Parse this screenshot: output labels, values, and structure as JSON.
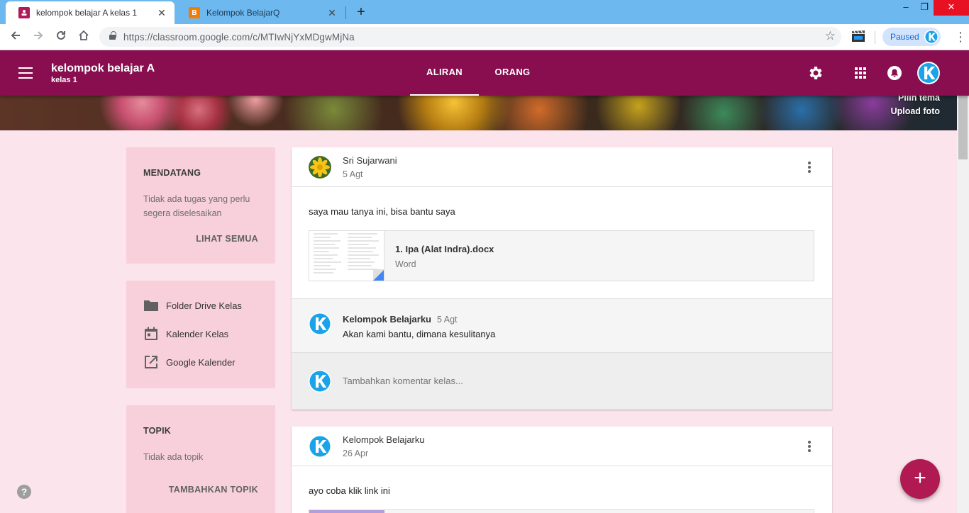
{
  "browser": {
    "tabs": [
      {
        "title": "kelompok belajar A kelas 1",
        "active": true,
        "favicon": "classroom-icon"
      },
      {
        "title": "Kelompok BelajarQ",
        "active": false,
        "favicon": "blogger-icon"
      }
    ],
    "window_controls": {
      "minimize": "–",
      "restore": "❐",
      "close": "✕"
    },
    "new_tab": "+",
    "url": "https://classroom.google.com/c/MTIwNjYxMDgwMjNa",
    "profile_status": "Paused",
    "colors": {
      "tabstrip": "#6cb8ef",
      "close_button": "#e81123"
    }
  },
  "header": {
    "class_name": "kelompok belajar A",
    "section": "kelas 1",
    "tabs": [
      {
        "label": "ALIRAN",
        "active": true
      },
      {
        "label": "ORANG",
        "active": false
      }
    ],
    "icons": [
      "gear-icon",
      "apps-grid-icon",
      "notifications-icon",
      "account-avatar"
    ],
    "color": "#880e4f"
  },
  "banner": {
    "select_theme": "Pilih tema",
    "upload_photo": "Upload foto"
  },
  "sidebar": {
    "upcoming": {
      "heading": "MENDATANG",
      "text": "Tidak ada tugas yang perlu segera diselesaikan",
      "action": "LIHAT SEMUA"
    },
    "links": [
      {
        "label": "Folder Drive Kelas",
        "icon": "folder-icon"
      },
      {
        "label": "Kalender Kelas",
        "icon": "calendar-icon"
      },
      {
        "label": "Google Kalender",
        "icon": "open-in-new-icon"
      }
    ],
    "topics": {
      "heading": "TOPIK",
      "text": "Tidak ada topik",
      "action": "TAMBAHKAN TOPIK"
    }
  },
  "posts": [
    {
      "author": "Sri Sujarwani",
      "date": "5 Agt",
      "body": "saya mau tanya ini, bisa bantu saya",
      "attachment": {
        "name": "1. Ipa (Alat Indra).docx",
        "type": "Word"
      },
      "comments": [
        {
          "author": "Kelompok Belajarku",
          "date": "5 Agt",
          "text": "Akan kami bantu, dimana kesulitanya"
        }
      ],
      "comment_placeholder": "Tambahkan komentar kelas..."
    },
    {
      "author": "Kelompok Belajarku",
      "date": "26 Apr",
      "body": "ayo coba klik link ini"
    }
  ],
  "help": "?",
  "fab": "+"
}
